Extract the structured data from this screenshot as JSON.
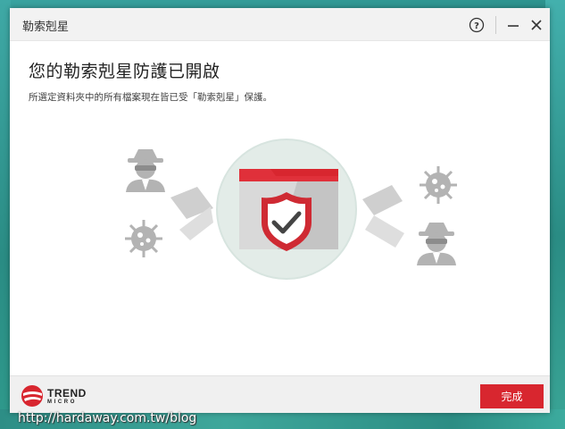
{
  "window": {
    "title": "勒索剋星",
    "help_label": "?",
    "heading": "您的勒索剋星防護已開啟",
    "description": "所選定資料夾中的所有檔案現在皆已受「勒索剋星」保護。"
  },
  "footer": {
    "logo_line1": "TREND",
    "logo_line2": "MICRO",
    "done_label": "完成"
  },
  "watermark": "http://hardaway.com.tw/blog",
  "colors": {
    "accent": "#d8262f",
    "icon_gray": "#b3b3b3",
    "shield_red": "#cf2a33",
    "circle_bg": "#e3ece8"
  }
}
